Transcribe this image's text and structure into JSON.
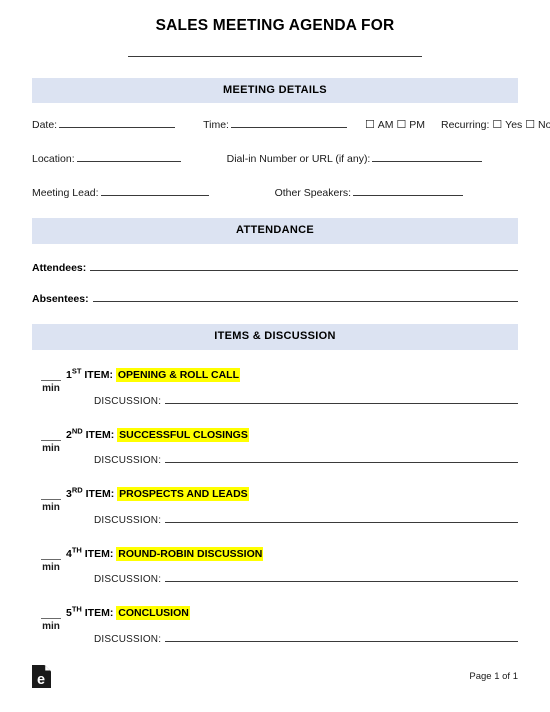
{
  "document": {
    "title": "SALES MEETING AGENDA FOR",
    "title_blank": ""
  },
  "sections": {
    "meeting_details": {
      "heading": "MEETING DETAILS",
      "fields": {
        "date_label": "Date:",
        "time_label": "Time:",
        "am_label": "AM",
        "pm_label": "PM",
        "recurring_label": "Recurring:",
        "yes_label": "Yes",
        "no_label": "No",
        "location_label": "Location:",
        "dialin_label": "Dial-in Number or URL (if any):",
        "meeting_lead_label": "Meeting Lead:",
        "other_speakers_label": "Other Speakers:"
      },
      "checkbox_glyph": "☐"
    },
    "attendance": {
      "heading": "ATTENDANCE",
      "rows": [
        {
          "label": "Attendees:",
          "value": ""
        },
        {
          "label": "Absentees:",
          "value": ""
        }
      ]
    },
    "items_discussion": {
      "heading": "ITEMS & DISCUSSION",
      "min_label": "min",
      "min_blank": "",
      "discussion_label": "DISCUSSION:",
      "items": [
        {
          "number": "1",
          "ordinal": "ST",
          "item_word": "ITEM:",
          "topic": "OPENING & ROLL CALL",
          "discussion_value": ""
        },
        {
          "number": "2",
          "ordinal": "ND",
          "item_word": "ITEM:",
          "topic": "SUCCESSFUL CLOSINGS",
          "discussion_value": ""
        },
        {
          "number": "3",
          "ordinal": "RD",
          "item_word": "ITEM:",
          "topic": "PROSPECTS AND LEADS",
          "discussion_value": ""
        },
        {
          "number": "4",
          "ordinal": "TH",
          "item_word": "ITEM:",
          "topic": "ROUND-ROBIN DISCUSSION",
          "discussion_value": ""
        },
        {
          "number": "5",
          "ordinal": "TH",
          "item_word": "ITEM:",
          "topic": "CONCLUSION",
          "discussion_value": ""
        }
      ]
    }
  },
  "footer": {
    "logo_name": "eforms-document-logo",
    "logo_letter": "e",
    "page_number": "Page 1 of 1"
  },
  "colors": {
    "band_background": "#dce3f2",
    "highlight": "#ffff00",
    "rule": "#3a3a3a",
    "text": "#000000",
    "logo": "#1a1a1a"
  }
}
